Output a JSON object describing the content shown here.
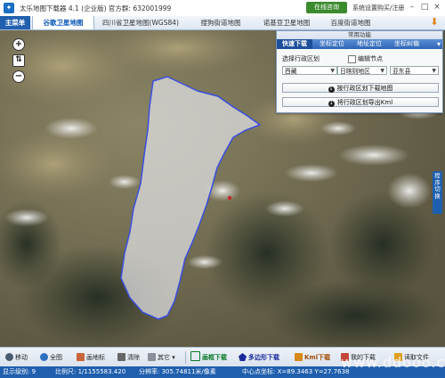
{
  "titlebar": {
    "title": "太乐地图下载器 4.1 (企业版) 官方群: 632001999",
    "online_btn": "在线咨询",
    "settings": "系统设置",
    "buy": "购买/注册"
  },
  "tabbar": {
    "main_menu": "主菜单",
    "tabs": [
      "谷歌卫星地图",
      "四川省卫星地图(WGS84)",
      "搜狗街道地图",
      "诺基亚卫星地图",
      "百度街道地图"
    ]
  },
  "panel": {
    "title": "常用功能",
    "tabs": [
      "快速下载",
      "坐标定位",
      "地址定位",
      "坐标纠偏"
    ],
    "label_region": "选择行政区划",
    "label_edit": "编辑节点",
    "province": "西藏",
    "city": "日喀则地区",
    "county": "亚东县",
    "btn_download": "按行政区划下载地图",
    "btn_export": "将行政区划导出Kml"
  },
  "side_switch": "程序切换",
  "toolbar": {
    "move": "移动",
    "full": "全图",
    "draw_mark": "画地标",
    "clear": "清除",
    "other": "其它",
    "rect_download": "画框下载",
    "polygon_download": "多边形下载",
    "kml_download": "Kml下载",
    "my_downloads": "我的下载",
    "read_file": "读取文件"
  },
  "status": {
    "level": "显示级别: 9",
    "scale": "比例尺: 1/1155583.420",
    "resolution": "分辨率: 305.74811米/像素",
    "center": "中心点坐标: X=89.3463 Y=27.7638"
  },
  "watermark": "www.ddooo.cc",
  "colors": {
    "brand_blue": "#1f5fae",
    "region_outline": "#3a4fe0",
    "online_green": "#3b8a2e"
  }
}
